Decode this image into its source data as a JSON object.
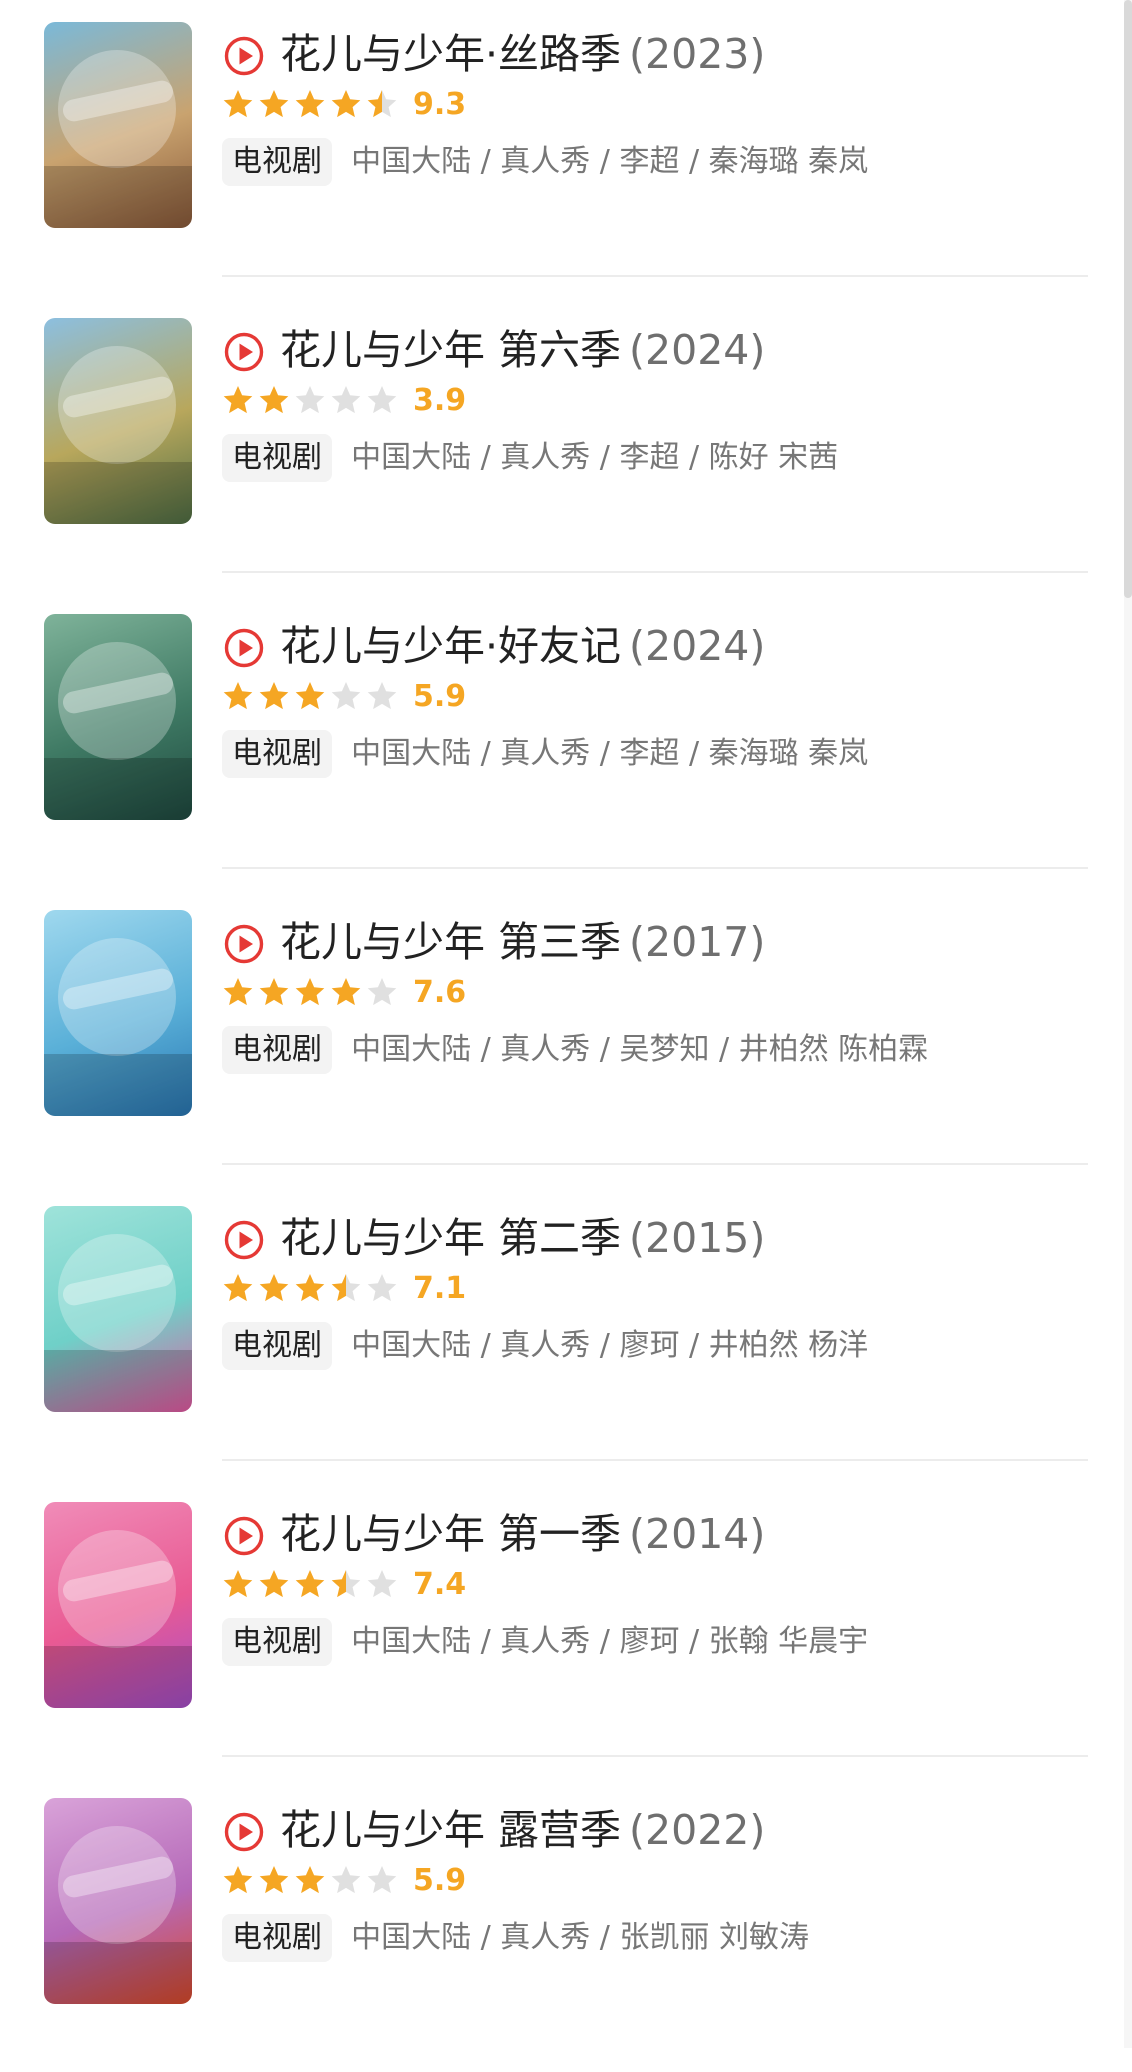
{
  "theme": {
    "accent": "#e53935",
    "star_on": "#f5a623",
    "star_off": "#e0e0e0"
  },
  "play_icon_name": "play-circle-icon",
  "star_icon_name": "star-icon",
  "items": [
    {
      "title": "花儿与少年·丝路季",
      "year": "(2023)",
      "rating_stars": 4.5,
      "score": "9.3",
      "tag": "电视剧",
      "info": "中国大陆 / 真人秀 / 李超 / 秦海璐 秦岚",
      "poster_icon": "variety-show-poster",
      "poster_colors": [
        "#7ab9d9",
        "#c9a36f",
        "#8a5a3a"
      ]
    },
    {
      "title": "花儿与少年 第六季",
      "year": "(2024)",
      "rating_stars": 2,
      "score": "3.9",
      "tag": "电视剧",
      "info": "中国大陆 / 真人秀 / 李超 / 陈好 宋茜",
      "poster_icon": "variety-show-poster",
      "poster_colors": [
        "#8cbfe0",
        "#b8a75c",
        "#4f6e44"
      ]
    },
    {
      "title": "花儿与少年·好友记",
      "year": "(2024)",
      "rating_stars": 3,
      "score": "5.9",
      "tag": "电视剧",
      "info": "中国大陆 / 真人秀 / 李超 / 秦海璐 秦岚",
      "poster_icon": "variety-show-poster",
      "poster_colors": [
        "#7fb39a",
        "#3f7a64",
        "#1f4a40"
      ]
    },
    {
      "title": "花儿与少年 第三季",
      "year": "(2017)",
      "rating_stars": 4,
      "score": "7.6",
      "tag": "电视剧",
      "info": "中国大陆 / 真人秀 / 吴梦知 / 井柏然 陈柏霖",
      "poster_icon": "variety-show-poster",
      "poster_colors": [
        "#9fd8ee",
        "#5ab0d8",
        "#2a78b4"
      ]
    },
    {
      "title": "花儿与少年 第二季",
      "year": "(2015)",
      "rating_stars": 3.5,
      "score": "7.1",
      "tag": "电视剧",
      "info": "中国大陆 / 真人秀 / 廖珂 / 井柏然 杨洋",
      "poster_icon": "variety-show-poster",
      "poster_colors": [
        "#9fe3da",
        "#6fd0c8",
        "#e35aa2"
      ]
    },
    {
      "title": "花儿与少年 第一季",
      "year": "(2014)",
      "rating_stars": 3.5,
      "score": "7.4",
      "tag": "电视剧",
      "info": "中国大陆 / 真人秀 / 廖珂 / 张翰 华晨宇",
      "poster_icon": "variety-show-poster",
      "poster_colors": [
        "#f08cb8",
        "#e95a93",
        "#a64fc9"
      ]
    },
    {
      "title": "花儿与少年 露营季",
      "year": "(2022)",
      "rating_stars": 3,
      "score": "5.9",
      "tag": "电视剧",
      "info": "中国大陆 / 真人秀 / 张凯丽 刘敏涛",
      "poster_icon": "variety-show-poster",
      "poster_colors": [
        "#d9a3d9",
        "#b569b8",
        "#d94a2a"
      ]
    }
  ]
}
